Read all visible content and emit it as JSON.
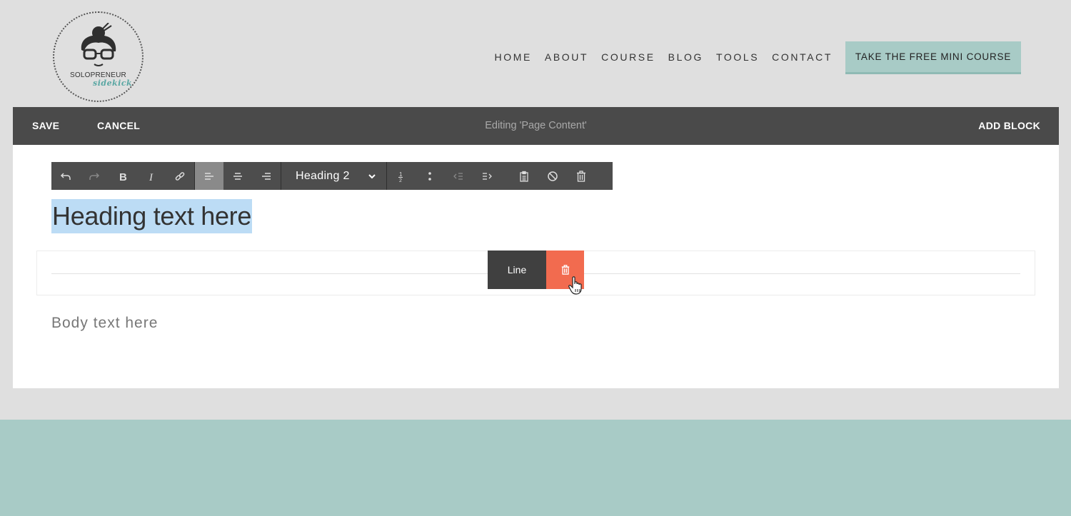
{
  "logo": {
    "line1": "SOLOPRENEUR",
    "line2": "sidekick"
  },
  "nav": {
    "items": [
      "HOME",
      "ABOUT",
      "COURSE",
      "BLOG",
      "TOOLS",
      "CONTACT"
    ],
    "cta": "TAKE THE FREE MINI COURSE"
  },
  "editbar": {
    "save": "SAVE",
    "cancel": "CANCEL",
    "title": "Editing 'Page Content'",
    "add_block": "ADD BLOCK"
  },
  "toolbar": {
    "format_label": "Heading 2",
    "icons": [
      "undo-icon",
      "redo-icon",
      "bold-icon",
      "italic-icon",
      "link-icon",
      "align-left-icon",
      "align-center-icon",
      "align-right-icon",
      "ordered-list-icon",
      "unordered-list-icon",
      "outdent-icon",
      "indent-icon",
      "paste-icon",
      "clear-format-icon",
      "delete-icon"
    ]
  },
  "content": {
    "heading": "Heading text here",
    "line_block_label": "Line",
    "body": "Body text here"
  },
  "colors": {
    "accent": "#a8cbc6",
    "delete": "#f26b4f",
    "editbar": "#4a4a4a",
    "selection": "#bcdcf5"
  }
}
